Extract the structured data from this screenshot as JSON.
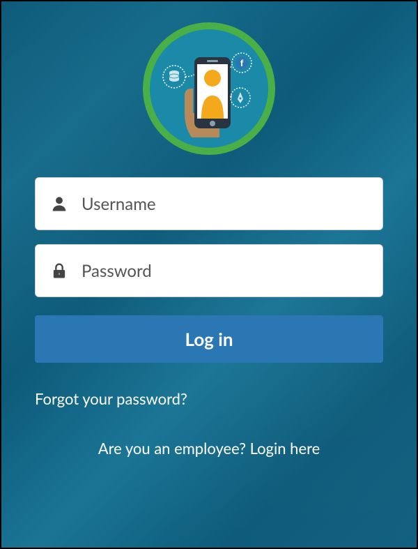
{
  "logo": {
    "icons": {
      "phone": "phone-icon",
      "person": "person-icon",
      "database": "database-icon",
      "facebook": "facebook-icon",
      "pen": "pen-icon"
    }
  },
  "form": {
    "username": {
      "placeholder": "Username",
      "value": ""
    },
    "password": {
      "placeholder": "Password",
      "value": ""
    },
    "login_label": "Log in"
  },
  "links": {
    "forgot": "Forgot your password?",
    "employee": "Are you an employee? Login here"
  },
  "colors": {
    "accent_green": "#4baf47",
    "button_blue": "#2b77b4",
    "bg_teal": "#0d5a7a"
  }
}
